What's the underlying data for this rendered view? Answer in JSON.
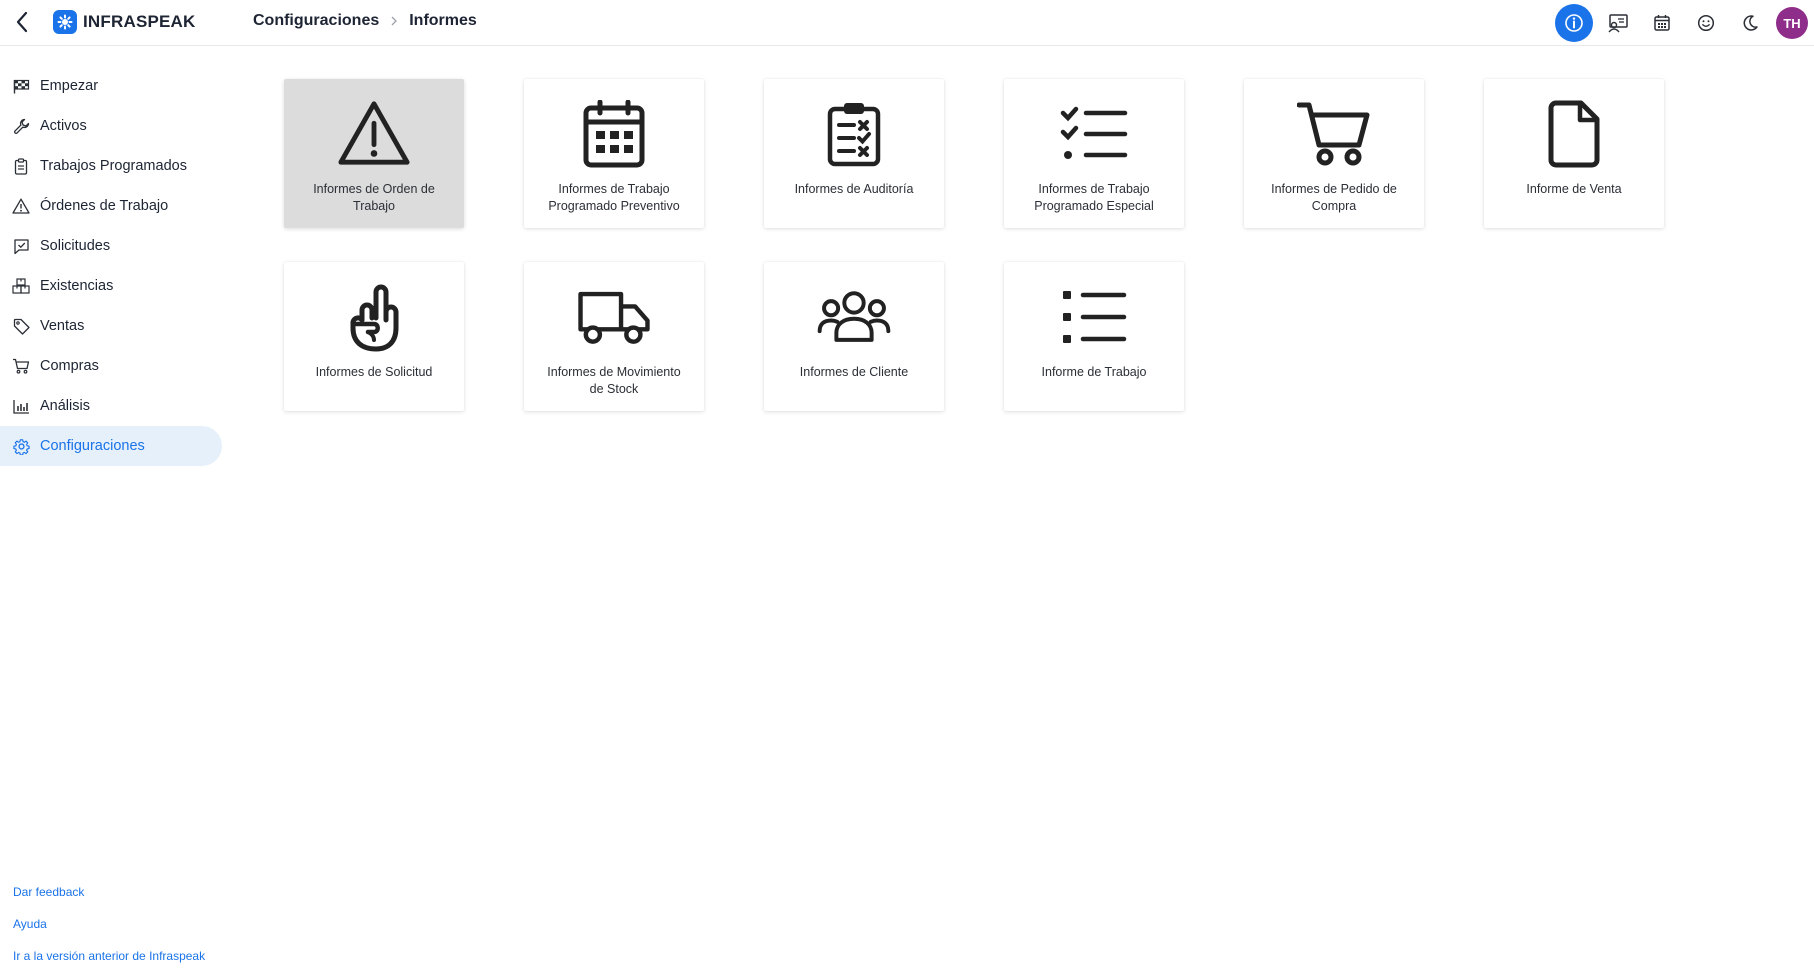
{
  "app": {
    "brand": "INFRASPEAK"
  },
  "breadcrumb": {
    "parent": "Configuraciones",
    "current": "Informes"
  },
  "topbar": {
    "avatar_initials": "TH",
    "icons": [
      "info-icon",
      "board-icon",
      "calendar-icon",
      "smiley-icon",
      "moon-icon"
    ]
  },
  "sidebar": {
    "items": [
      {
        "label": "Empezar",
        "icon": "flag-icon"
      },
      {
        "label": "Activos",
        "icon": "wrench-icon"
      },
      {
        "label": "Trabajos Programados",
        "icon": "clipboard-icon"
      },
      {
        "label": "Órdenes de Trabajo",
        "icon": "warning-icon"
      },
      {
        "label": "Solicitudes",
        "icon": "chat-check-icon"
      },
      {
        "label": "Existencias",
        "icon": "boxes-icon"
      },
      {
        "label": "Ventas",
        "icon": "tag-icon"
      },
      {
        "label": "Compras",
        "icon": "cart-icon"
      },
      {
        "label": "Análisis",
        "icon": "bar-chart-icon"
      },
      {
        "label": "Configuraciones",
        "icon": "gear-icon",
        "active": true
      }
    ],
    "footer": {
      "feedback": "Dar feedback",
      "help": "Ayuda",
      "old_version": "Ir a la versión anterior de Infraspeak"
    }
  },
  "reports": [
    {
      "label": "Informes de Orden de Trabajo",
      "icon": "warning-triangle-icon",
      "selected": true
    },
    {
      "label": "Informes de Trabajo Programado Preventivo",
      "icon": "calendar-icon"
    },
    {
      "label": "Informes de Auditoría",
      "icon": "clipboard-checklist-icon"
    },
    {
      "label": "Informes de Trabajo Programado Especial",
      "icon": "checklist-icon"
    },
    {
      "label": "Informes de Pedido de Compra",
      "icon": "shopping-cart-icon"
    },
    {
      "label": "Informe de Venta",
      "icon": "document-icon"
    },
    {
      "label": "Informes de Solicitud",
      "icon": "hand-pointing-icon"
    },
    {
      "label": "Informes de Movimiento de Stock",
      "icon": "truck-icon"
    },
    {
      "label": "Informes de Cliente",
      "icon": "users-icon"
    },
    {
      "label": "Informe de Trabajo",
      "icon": "list-icon"
    }
  ],
  "colors": {
    "accent": "#1a73e8",
    "active_bg": "#e6f0fb",
    "avatar": "#8e2e8a",
    "selected_card": "#dcdcdc"
  }
}
